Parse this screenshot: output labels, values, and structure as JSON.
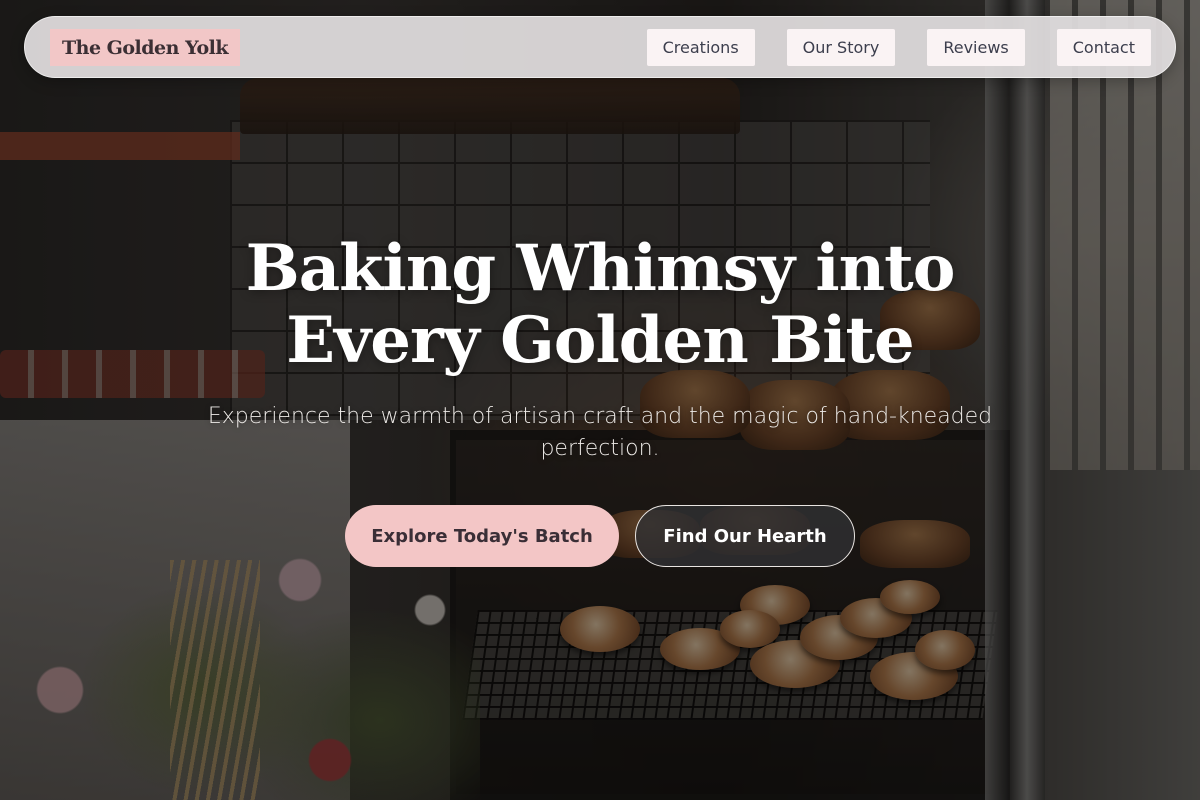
{
  "brand": {
    "name": "The Golden Yolk",
    "accent_color": "#f2c7c7"
  },
  "nav": {
    "items": [
      {
        "label": "Creations"
      },
      {
        "label": "Our Story"
      },
      {
        "label": "Reviews"
      },
      {
        "label": "Contact"
      }
    ]
  },
  "hero": {
    "title_line1": "Baking Whimsy into",
    "title_line2": "Every Golden Bite",
    "subtitle": "Experience the warmth of artisan craft and the magic of hand-kneaded perfection.",
    "primary_cta": "Explore Today's Batch",
    "secondary_cta": "Find Our Hearth",
    "background_image": "bakery-display-case-photo"
  },
  "colors": {
    "primary_button": "#f3c6c6",
    "secondary_button": "#303032",
    "nav_background": "#e2dfe0",
    "nav_link_background": "#faf3f4"
  }
}
